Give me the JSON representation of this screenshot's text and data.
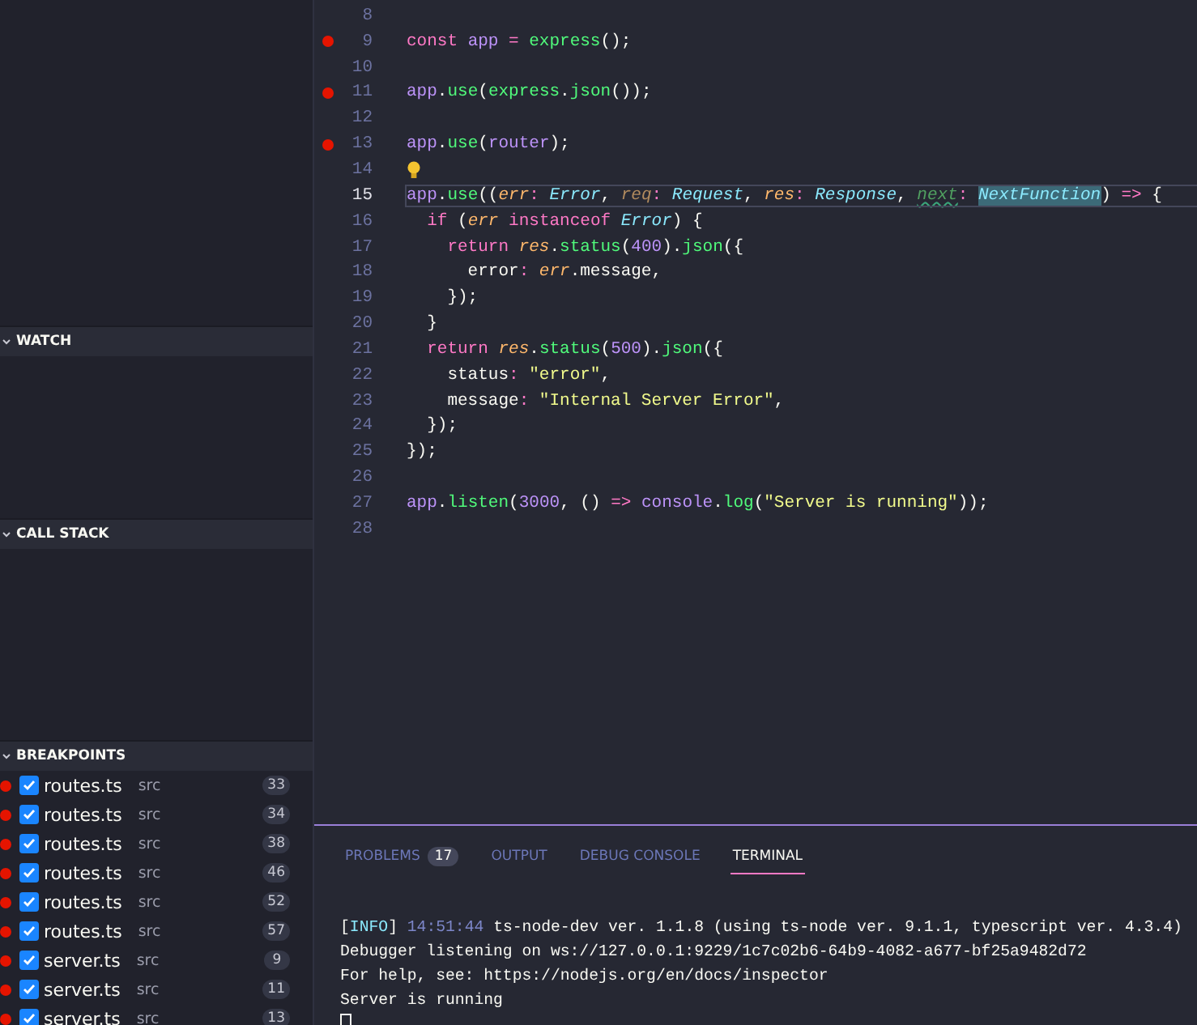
{
  "sidebar": {
    "sections": [
      {
        "title": "WATCH",
        "expanded": true
      },
      {
        "title": "CALL STACK",
        "expanded": true
      },
      {
        "title": "BREAKPOINTS",
        "expanded": true
      }
    ],
    "breakpoints": [
      {
        "file": "routes.ts",
        "folder": "src",
        "line": "33",
        "checked": true
      },
      {
        "file": "routes.ts",
        "folder": "src",
        "line": "34",
        "checked": true
      },
      {
        "file": "routes.ts",
        "folder": "src",
        "line": "38",
        "checked": true
      },
      {
        "file": "routes.ts",
        "folder": "src",
        "line": "46",
        "checked": true
      },
      {
        "file": "routes.ts",
        "folder": "src",
        "line": "52",
        "checked": true
      },
      {
        "file": "routes.ts",
        "folder": "src",
        "line": "57",
        "checked": true
      },
      {
        "file": "server.ts",
        "folder": "src",
        "line": "9",
        "checked": true
      },
      {
        "file": "server.ts",
        "folder": "src",
        "line": "11",
        "checked": true
      },
      {
        "file": "server.ts",
        "folder": "src",
        "line": "13",
        "checked": true
      }
    ]
  },
  "editor": {
    "lines": [
      {
        "number": "8",
        "breakpoint": false,
        "current": false
      },
      {
        "number": "9",
        "breakpoint": true,
        "current": false,
        "tokens": [
          {
            "text": "const ",
            "kind": "keyword"
          },
          {
            "text": "app",
            "kind": "variable"
          },
          {
            "text": " = ",
            "kind": "operator"
          },
          {
            "text": "express",
            "kind": "function"
          },
          {
            "text": "();",
            "kind": "plain"
          }
        ]
      },
      {
        "number": "10",
        "breakpoint": false,
        "current": false
      },
      {
        "number": "11",
        "breakpoint": true,
        "current": false,
        "tokens": [
          {
            "text": "app",
            "kind": "variable"
          },
          {
            "text": ".",
            "kind": "plain"
          },
          {
            "text": "use",
            "kind": "function"
          },
          {
            "text": "(",
            "kind": "plain"
          },
          {
            "text": "express",
            "kind": "function"
          },
          {
            "text": ".",
            "kind": "plain"
          },
          {
            "text": "json",
            "kind": "function"
          },
          {
            "text": "());",
            "kind": "plain"
          }
        ]
      },
      {
        "number": "12",
        "breakpoint": false,
        "current": false
      },
      {
        "number": "13",
        "breakpoint": true,
        "current": false,
        "tokens": [
          {
            "text": "app",
            "kind": "variable"
          },
          {
            "text": ".",
            "kind": "plain"
          },
          {
            "text": "use",
            "kind": "function"
          },
          {
            "text": "(",
            "kind": "plain"
          },
          {
            "text": "router",
            "kind": "variable"
          },
          {
            "text": ");",
            "kind": "plain"
          }
        ]
      },
      {
        "number": "14",
        "breakpoint": false,
        "current": false,
        "lightbulb": true
      },
      {
        "number": "15",
        "breakpoint": false,
        "current": true,
        "tokens": [
          {
            "text": "app",
            "kind": "variable"
          },
          {
            "text": ".",
            "kind": "plain"
          },
          {
            "text": "use",
            "kind": "function"
          },
          {
            "text": "((",
            "kind": "plain"
          },
          {
            "text": "err",
            "kind": "param"
          },
          {
            "text": ": ",
            "kind": "operator"
          },
          {
            "text": "Error",
            "kind": "type"
          },
          {
            "text": ", ",
            "kind": "plain"
          },
          {
            "text": "req",
            "kind": "unused"
          },
          {
            "text": ": ",
            "kind": "operator"
          },
          {
            "text": "Request",
            "kind": "type"
          },
          {
            "text": ", ",
            "kind": "plain"
          },
          {
            "text": "res",
            "kind": "param"
          },
          {
            "text": ": ",
            "kind": "operator"
          },
          {
            "text": "Response",
            "kind": "type"
          },
          {
            "text": ", ",
            "kind": "plain"
          },
          {
            "text": "next",
            "kind": "warning"
          },
          {
            "text": ": ",
            "kind": "operator"
          },
          {
            "text": "NextFunction",
            "kind": "selected"
          },
          {
            "text": ")",
            "kind": "plain"
          },
          {
            "text": " => ",
            "kind": "operator"
          },
          {
            "text": "{",
            "kind": "plain"
          }
        ]
      },
      {
        "number": "16",
        "breakpoint": false,
        "current": false,
        "tokens": [
          {
            "text": "  if ",
            "kind": "keyword"
          },
          {
            "text": "(",
            "kind": "plain"
          },
          {
            "text": "err",
            "kind": "param"
          },
          {
            "text": " instanceof ",
            "kind": "keyword"
          },
          {
            "text": "Error",
            "kind": "type"
          },
          {
            "text": ") {",
            "kind": "plain"
          }
        ]
      },
      {
        "number": "17",
        "breakpoint": false,
        "current": false,
        "tokens": [
          {
            "text": "    return ",
            "kind": "keyword"
          },
          {
            "text": "res",
            "kind": "param"
          },
          {
            "text": ".",
            "kind": "plain"
          },
          {
            "text": "status",
            "kind": "function"
          },
          {
            "text": "(",
            "kind": "plain"
          },
          {
            "text": "400",
            "kind": "number"
          },
          {
            "text": ").",
            "kind": "plain"
          },
          {
            "text": "json",
            "kind": "function"
          },
          {
            "text": "({",
            "kind": "plain"
          }
        ]
      },
      {
        "number": "18",
        "breakpoint": false,
        "current": false,
        "tokens": [
          {
            "text": "      error",
            "kind": "plain"
          },
          {
            "text": ": ",
            "kind": "operator"
          },
          {
            "text": "err",
            "kind": "param"
          },
          {
            "text": ".message,",
            "kind": "plain"
          }
        ]
      },
      {
        "number": "19",
        "breakpoint": false,
        "current": false,
        "tokens": [
          {
            "text": "    });",
            "kind": "plain"
          }
        ]
      },
      {
        "number": "20",
        "breakpoint": false,
        "current": false,
        "tokens": [
          {
            "text": "  }",
            "kind": "plain"
          }
        ]
      },
      {
        "number": "21",
        "breakpoint": false,
        "current": false,
        "tokens": [
          {
            "text": "  return ",
            "kind": "keyword"
          },
          {
            "text": "res",
            "kind": "param"
          },
          {
            "text": ".",
            "kind": "plain"
          },
          {
            "text": "status",
            "kind": "function"
          },
          {
            "text": "(",
            "kind": "plain"
          },
          {
            "text": "500",
            "kind": "number"
          },
          {
            "text": ").",
            "kind": "plain"
          },
          {
            "text": "json",
            "kind": "function"
          },
          {
            "text": "({",
            "kind": "plain"
          }
        ]
      },
      {
        "number": "22",
        "breakpoint": false,
        "current": false,
        "tokens": [
          {
            "text": "    status",
            "kind": "plain"
          },
          {
            "text": ": ",
            "kind": "operator"
          },
          {
            "text": "\"error\"",
            "kind": "string"
          },
          {
            "text": ",",
            "kind": "plain"
          }
        ]
      },
      {
        "number": "23",
        "breakpoint": false,
        "current": false,
        "tokens": [
          {
            "text": "    message",
            "kind": "plain"
          },
          {
            "text": ": ",
            "kind": "operator"
          },
          {
            "text": "\"Internal Server Error\"",
            "kind": "string"
          },
          {
            "text": ",",
            "kind": "plain"
          }
        ]
      },
      {
        "number": "24",
        "breakpoint": false,
        "current": false,
        "tokens": [
          {
            "text": "  });",
            "kind": "plain"
          }
        ]
      },
      {
        "number": "25",
        "breakpoint": false,
        "current": false,
        "tokens": [
          {
            "text": "});",
            "kind": "plain"
          }
        ]
      },
      {
        "number": "26",
        "breakpoint": false,
        "current": false
      },
      {
        "number": "27",
        "breakpoint": false,
        "current": false,
        "tokens": [
          {
            "text": "app",
            "kind": "variable"
          },
          {
            "text": ".",
            "kind": "plain"
          },
          {
            "text": "listen",
            "kind": "function"
          },
          {
            "text": "(",
            "kind": "plain"
          },
          {
            "text": "3000",
            "kind": "number"
          },
          {
            "text": ", () ",
            "kind": "plain"
          },
          {
            "text": "=> ",
            "kind": "operator"
          },
          {
            "text": "console",
            "kind": "variable"
          },
          {
            "text": ".",
            "kind": "plain"
          },
          {
            "text": "log",
            "kind": "function"
          },
          {
            "text": "(",
            "kind": "plain"
          },
          {
            "text": "\"Server is running\"",
            "kind": "string"
          },
          {
            "text": "));",
            "kind": "plain"
          }
        ]
      },
      {
        "number": "28",
        "breakpoint": false,
        "current": false
      }
    ]
  },
  "panel": {
    "tabs": [
      {
        "label": "PROBLEMS",
        "badge": "17",
        "selected": false
      },
      {
        "label": "OUTPUT",
        "selected": false
      },
      {
        "label": "DEBUG CONSOLE",
        "selected": false
      },
      {
        "label": "TERMINAL",
        "selected": true
      }
    ],
    "terminal": [
      [
        {
          "text": "[",
          "kind": "plain"
        },
        {
          "text": "INFO",
          "kind": "info"
        },
        {
          "text": "] ",
          "kind": "plain"
        },
        {
          "text": "14:51:44",
          "kind": "time"
        },
        {
          "text": " ts-node-dev ver. 1.1.8 (using ts-node ver. 9.1.1, typescript ver. 4.3.4)",
          "kind": "plain"
        }
      ],
      [
        {
          "text": "Debugger listening on ws://127.0.0.1:9229/1c7c02b6-64b9-4082-a677-bf25a9482d72",
          "kind": "plain"
        }
      ],
      [
        {
          "text": "For help, see: https://nodejs.org/en/docs/inspector",
          "kind": "plain"
        }
      ],
      [
        {
          "text": "Server is running",
          "kind": "plain"
        }
      ]
    ]
  }
}
